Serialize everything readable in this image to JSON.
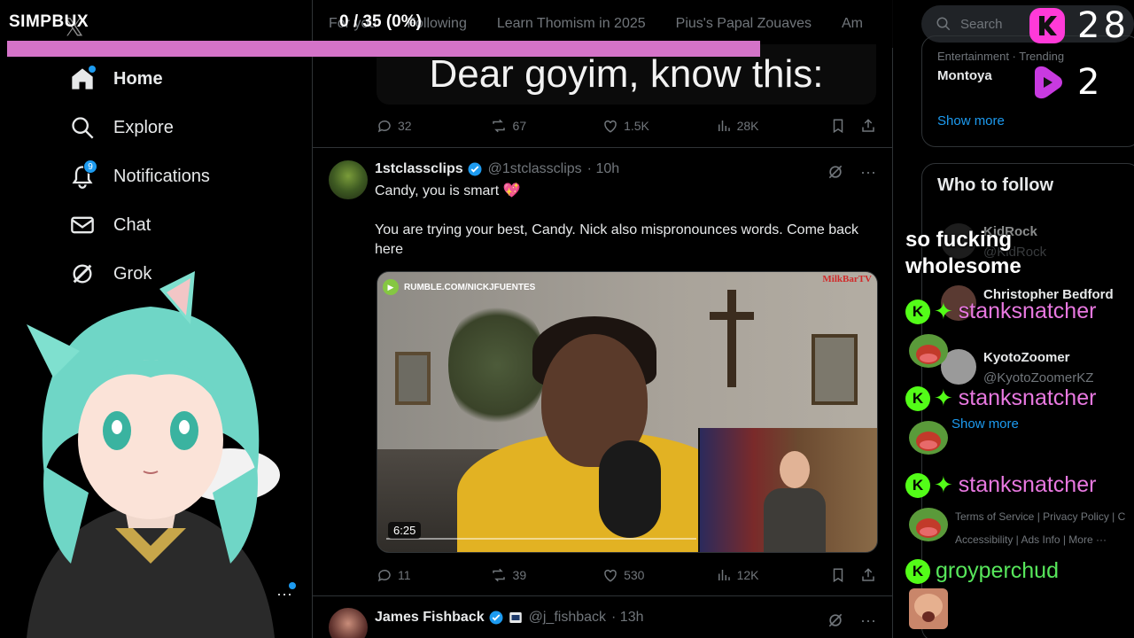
{
  "overlay": {
    "brand": "SIMPBUX",
    "progress_text": "0 / 35 (0%)",
    "progress_fraction": 0.0,
    "progress_color": "#d473c8"
  },
  "sidebar": {
    "items": [
      {
        "label": "Home",
        "icon": "home-icon",
        "active": true
      },
      {
        "label": "Explore",
        "icon": "search-icon"
      },
      {
        "label": "Notifications",
        "icon": "bell-icon",
        "badge": "9"
      },
      {
        "label": "Chat",
        "icon": "mail-icon"
      },
      {
        "label": "Grok",
        "icon": "grok-icon"
      }
    ]
  },
  "tabs": [
    "For you",
    "Following",
    "Learn Thomism in 2025",
    "Pius's Papal Zouaves",
    "Am"
  ],
  "feed": {
    "first_tweet": {
      "media_caption": "Dear goyim, know this:",
      "replies": "32",
      "reposts": "67",
      "likes": "1.5K",
      "views": "28K"
    },
    "second_tweet": {
      "name": "1stclassclips",
      "handle": "@1stclassclips",
      "time": "· 10h",
      "line1": "Candy, you is smart 💖",
      "line2": "You are trying your best, Candy. Nick also mispronounces words. Come back here",
      "video_source": "RUMBLE.COM/NICKJFUENTES",
      "video_watermark": "MilkBarTV",
      "duration": "6:25",
      "replies": "11",
      "reposts": "39",
      "likes": "530",
      "views": "12K"
    },
    "third_tweet": {
      "name": "James Fishback",
      "handle": "@j_fishback",
      "time": "· 13h"
    }
  },
  "right": {
    "search_placeholder": "Search",
    "trend_category": "Entertainment · Trending",
    "trend_name": "Montoya",
    "show_more": "Show more",
    "who_to_follow": "Who to follow",
    "follows": [
      {
        "name": "KidRock",
        "handle": "@KidRock"
      },
      {
        "name": "Christopher Bedford",
        "handle": ""
      },
      {
        "name": "KyotoZoomer",
        "handle": "@KyotoZoomerKZ"
      }
    ],
    "show_more_2": "Show more",
    "footer_1": "Terms of Service  |  Privacy Policy  |  C",
    "footer_2": "Accessibility  |  Ads Info  |  More ···"
  },
  "counters": {
    "kick_count": "28",
    "rumble_count": "2",
    "kick_color": "#ff3ad8",
    "rumble_color": "#c83ae0"
  },
  "chat": {
    "message_1": "so fucking wholesome",
    "user_1": "stanksnatcher",
    "user_2": "stanksnatcher",
    "user_3": "stanksnatcher",
    "user_4": "groyperchud"
  }
}
